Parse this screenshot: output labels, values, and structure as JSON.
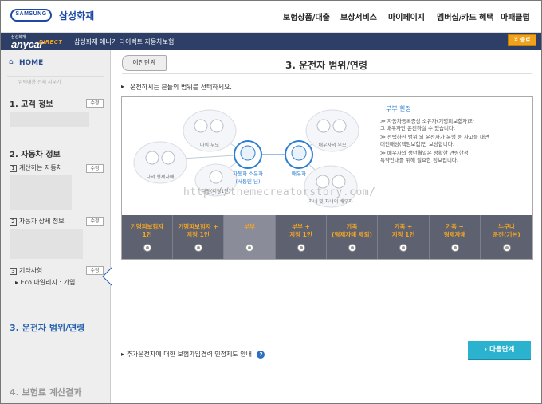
{
  "brand": {
    "logo_en": "SAMSUNG",
    "logo_ko": "삼성화재",
    "small": "삼성화재",
    "anycar": "anycar",
    "direct": "DIRECT",
    "bar_title": "삼성화재 애니카 다이렉트 자동차보험",
    "close": "✕ 종료"
  },
  "nav": [
    "보험상품/대출",
    "보상서비스",
    "마이페이지",
    "멤버십/카드 혜택",
    "마패클럽"
  ],
  "sidebar": {
    "home": "HOME",
    "reset": "입력내용 전체 지우기",
    "edit": "수정",
    "s1": "1. 고객 정보",
    "s2": "2. 자동차 정보",
    "s2a": "계산하는 자동차",
    "s2b": "자동차 상세 정보",
    "s2c": "기타사항",
    "eco": "▸ Eco 마일리지 : 가입",
    "s3": "3. 운전자 범위/연령",
    "s4": "4. 보험료 계산결과"
  },
  "main": {
    "prev": "이전단계",
    "title": "3. 운전자 범위/연령",
    "instruction": "운전하시는 분들의 범위를 선택하세요.",
    "notice": "추가운전자에 대한 보험가입경력 인정제도 안내",
    "next": "› 다음단계"
  },
  "diagram": {
    "parents_self": "나의 부모",
    "parents_spouse": "배우자의 부모",
    "siblings": "나의 형제자매",
    "others": "타인(지정1인)",
    "owner": "자동차 소유자",
    "owner_name": "(서동민 님)",
    "spouse": "배우자",
    "children": "자녀 및 자녀의 배우자"
  },
  "info": {
    "title": "부부 한정",
    "lines": [
      "≫ 자동차등록증상 소유자(기명피보험자)와",
      "   그 배우자만 운전하실 수 있습니다.",
      "≫ 선택하신 범위 외 운전자가 운행 중 사고를 내면",
      "   대인배상(책임보험)만 보상합니다.",
      "≫ 배우자의 생년월일은 정확한 연령한정",
      "   특약안내를 위해 필요한 정보입니다."
    ]
  },
  "options": [
    {
      "line1": "기명피보험자",
      "line2": "1인"
    },
    {
      "line1": "기명피보험자 +",
      "line2": "지정 1인"
    },
    {
      "line1": "부부",
      "line2": ""
    },
    {
      "line1": "부부 +",
      "line2": "지정 1인"
    },
    {
      "line1": "가족",
      "line2": "(형제자매 제외)"
    },
    {
      "line1": "가족 +",
      "line2": "지정 1인"
    },
    {
      "line1": "가족 +",
      "line2": "형제자매"
    },
    {
      "line1": "누구나",
      "line2": "운전(기본)"
    }
  ],
  "selected_option": 2,
  "watermark": "http://themecreatorstory.com/",
  "colors": {
    "brand_blue": "#1b49a6",
    "bar": "#2d3f66",
    "accent": "#2561ad",
    "next": "#2bb2cf",
    "orange": "#f5a623"
  }
}
